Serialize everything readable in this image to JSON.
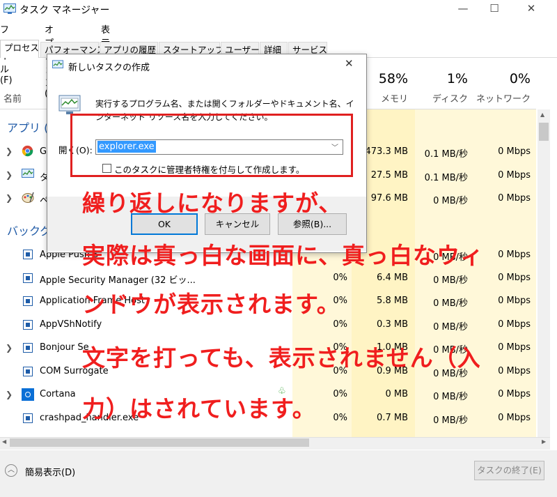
{
  "window": {
    "title": "タスク マネージャー",
    "minimize": "—",
    "maximize": "☐",
    "close": "✕"
  },
  "menu": [
    "ファイル(F)",
    "オプション(O)",
    "表示(V)"
  ],
  "tabs": [
    "プロセス",
    "パフォーマンス",
    "アプリの履歴",
    "スタートアップ",
    "ユーザー",
    "詳細",
    "サービス"
  ],
  "header": {
    "name_col": "名前",
    "memory_pct": "58%",
    "memory_label": "メモリ",
    "disk_pct": "1%",
    "disk_label": "ディスク",
    "network_pct": "0%",
    "network_label": "ネットワーク"
  },
  "groups": {
    "apps": "アプリ (5",
    "background": "バックグ"
  },
  "app_rows": [
    {
      "name": "G",
      "memory": "473.3 MB",
      "disk": "0.1 MB/秒",
      "network": "0 Mbps"
    },
    {
      "name": "タ",
      "memory": "27.5 MB",
      "disk": "0.1 MB/秒",
      "network": "0 Mbps"
    },
    {
      "name": "ペ",
      "memory": "97.6 MB",
      "disk": "0 MB/秒",
      "network": "0 Mbps"
    }
  ],
  "bg_rows": [
    {
      "name": "Apple Push S",
      "cpu": "",
      "memory": "",
      "disk": "0 MB/秒",
      "network": "0 Mbps"
    },
    {
      "name": "Apple Security Manager (32 ビッ...",
      "cpu": "0%",
      "memory": "6.4 MB",
      "disk": "0 MB/秒",
      "network": "0 Mbps"
    },
    {
      "name": "Application Frame Host",
      "cpu": "0%",
      "memory": "5.8 MB",
      "disk": "0 MB/秒",
      "network": "0 Mbps"
    },
    {
      "name": "AppVShNotify",
      "cpu": "0%",
      "memory": "0.3 MB",
      "disk": "0 MB/秒",
      "network": "0 Mbps"
    },
    {
      "name": "Bonjour Se",
      "cpu": "0%",
      "memory": "1.0 MB",
      "disk": "0 MB/秒",
      "network": "0 Mbps"
    },
    {
      "name": "COM Surrogate",
      "cpu": "0%",
      "memory": "0.9 MB",
      "disk": "0 MB/秒",
      "network": "0 Mbps"
    },
    {
      "name": "Cortana",
      "cpu": "0%",
      "memory": "0 MB",
      "disk": "0 MB/秒",
      "network": "0 Mbps"
    },
    {
      "name": "crashpad_handler.exe",
      "cpu": "0%",
      "memory": "0.7 MB",
      "disk": "0 MB/秒",
      "network": "0 Mbps"
    }
  ],
  "footer": {
    "fewer_details": "簡易表示(D)",
    "end_task": "タスクの終了(E)"
  },
  "dialog": {
    "title": "新しいタスクの作成",
    "close": "✕",
    "desc_line1": "実行するプログラム名、または開くフォルダーやドキュメント名、イ",
    "desc_line2": "ンターネット リソース名を入力してください。",
    "open_label": "開く(O):",
    "open_value": "explorer.exe",
    "admin_label": "このタスクに管理者特権を付与して作成します。",
    "ok": "OK",
    "cancel": "キャンセル",
    "browse": "参照(B)..."
  },
  "annotation": {
    "line1": "繰り返しになりますが、",
    "line2": "実際は真っ白な画面に、真っ白なウィ",
    "line3": "ンドウが表示されます。",
    "line4": "文字を打っても、表示されません（入",
    "line5": "力）はされています。"
  },
  "colors": {
    "annotation_red": "#f01e1e",
    "highlight_yellow": "#fff4c4",
    "group_blue": "#1f5aa6",
    "selection_blue": "#3399ff"
  }
}
